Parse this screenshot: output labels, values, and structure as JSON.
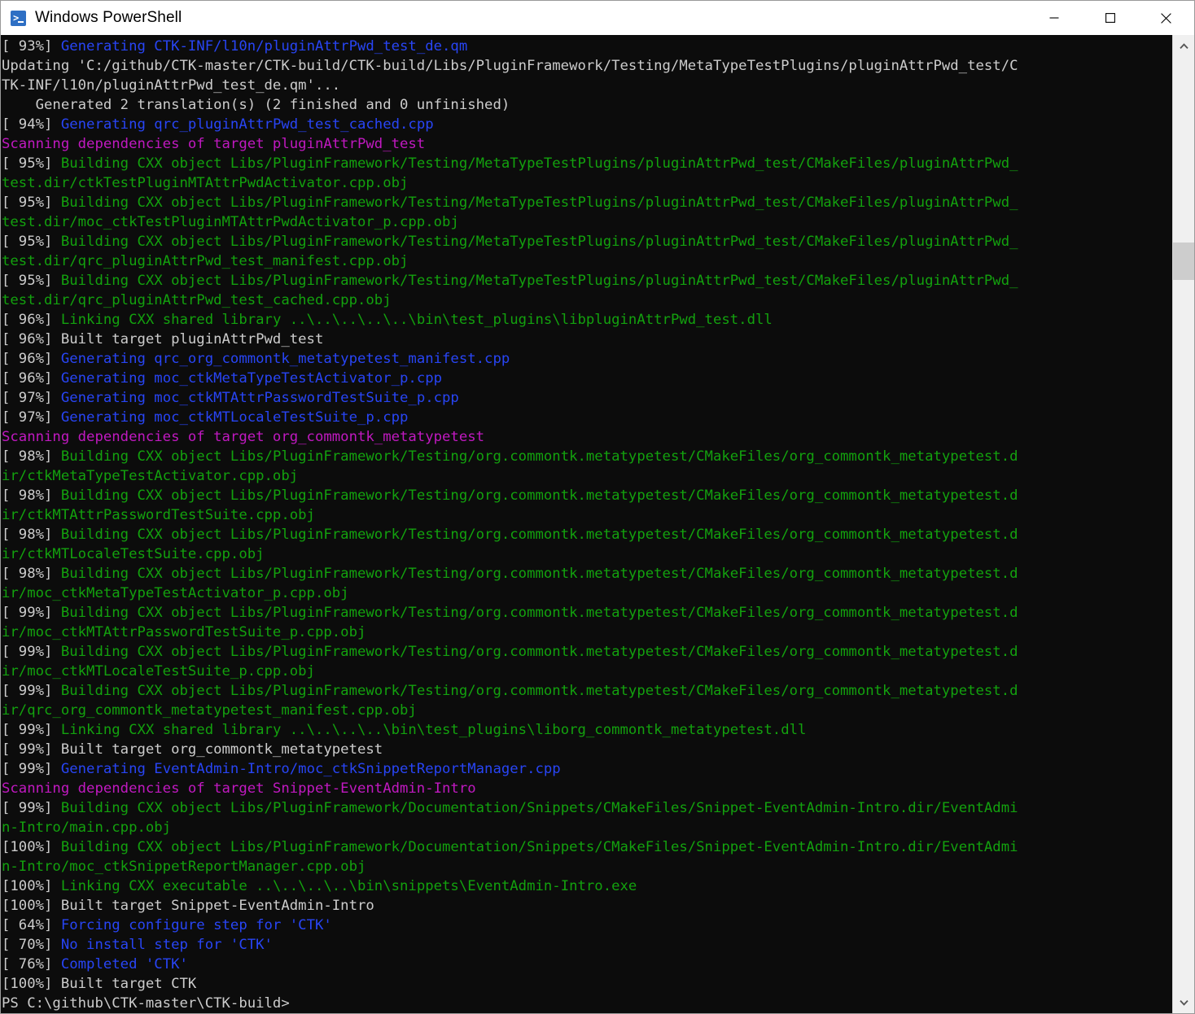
{
  "window": {
    "title": "Windows PowerShell",
    "icon": "powershell-icon",
    "controls": {
      "minimize_label": "Minimize",
      "maximize_label": "Maximize",
      "close_label": "Close"
    }
  },
  "theme": {
    "background": "#0c0c0c",
    "default_text": "#cccccc",
    "green": "#13a10e",
    "blue": "#2845f5",
    "magenta": "#c019c0",
    "titlebar_background": "#ffffff",
    "titlebar_text": "#000000",
    "scrollbar_track": "#f0f0f0",
    "scrollbar_thumb": "#cdcdcd"
  },
  "scrollbar": {
    "up_arrow": "chevron-up-icon",
    "down_arrow": "chevron-down-icon",
    "thumb_label": "scroll-thumb"
  },
  "terminal": {
    "prompt": "PS C:\\github\\CTK-master\\CTK-build>",
    "lines": [
      {
        "segments": [
          {
            "t": "[ 93%] ",
            "c": "c-white"
          },
          {
            "t": "Generating CTK-INF/l10n/pluginAttrPwd_test_de.qm",
            "c": "c-blue"
          }
        ]
      },
      {
        "segments": [
          {
            "t": "Updating 'C:/github/CTK-master/CTK-build/CTK-build/Libs/PluginFramework/Testing/MetaTypeTestPlugins/pluginAttrPwd_test/C",
            "c": "c-white"
          }
        ]
      },
      {
        "segments": [
          {
            "t": "TK-INF/l10n/pluginAttrPwd_test_de.qm'...",
            "c": "c-white"
          }
        ]
      },
      {
        "segments": [
          {
            "t": "    Generated 2 translation(s) (2 finished and 0 unfinished)",
            "c": "c-white"
          }
        ]
      },
      {
        "segments": [
          {
            "t": "[ 94%] ",
            "c": "c-white"
          },
          {
            "t": "Generating qrc_pluginAttrPwd_test_cached.cpp",
            "c": "c-blue"
          }
        ]
      },
      {
        "segments": [
          {
            "t": "Scanning dependencies of target pluginAttrPwd_test",
            "c": "c-magenta"
          }
        ]
      },
      {
        "segments": [
          {
            "t": "[ 95%] ",
            "c": "c-white"
          },
          {
            "t": "Building CXX object Libs/PluginFramework/Testing/MetaTypeTestPlugins/pluginAttrPwd_test/CMakeFiles/pluginAttrPwd_",
            "c": "c-green"
          }
        ]
      },
      {
        "segments": [
          {
            "t": "test.dir/ctkTestPluginMTAttrPwdActivator.cpp.obj",
            "c": "c-green"
          }
        ]
      },
      {
        "segments": [
          {
            "t": "[ 95%] ",
            "c": "c-white"
          },
          {
            "t": "Building CXX object Libs/PluginFramework/Testing/MetaTypeTestPlugins/pluginAttrPwd_test/CMakeFiles/pluginAttrPwd_",
            "c": "c-green"
          }
        ]
      },
      {
        "segments": [
          {
            "t": "test.dir/moc_ctkTestPluginMTAttrPwdActivator_p.cpp.obj",
            "c": "c-green"
          }
        ]
      },
      {
        "segments": [
          {
            "t": "[ 95%] ",
            "c": "c-white"
          },
          {
            "t": "Building CXX object Libs/PluginFramework/Testing/MetaTypeTestPlugins/pluginAttrPwd_test/CMakeFiles/pluginAttrPwd_",
            "c": "c-green"
          }
        ]
      },
      {
        "segments": [
          {
            "t": "test.dir/qrc_pluginAttrPwd_test_manifest.cpp.obj",
            "c": "c-green"
          }
        ]
      },
      {
        "segments": [
          {
            "t": "[ 95%] ",
            "c": "c-white"
          },
          {
            "t": "Building CXX object Libs/PluginFramework/Testing/MetaTypeTestPlugins/pluginAttrPwd_test/CMakeFiles/pluginAttrPwd_",
            "c": "c-green"
          }
        ]
      },
      {
        "segments": [
          {
            "t": "test.dir/qrc_pluginAttrPwd_test_cached.cpp.obj",
            "c": "c-green"
          }
        ]
      },
      {
        "segments": [
          {
            "t": "[ 96%] ",
            "c": "c-white"
          },
          {
            "t": "Linking CXX shared library ..\\..\\..\\..\\..\\bin\\test_plugins\\libpluginAttrPwd_test.dll",
            "c": "c-green"
          }
        ]
      },
      {
        "segments": [
          {
            "t": "[ 96%] Built target pluginAttrPwd_test",
            "c": "c-white"
          }
        ]
      },
      {
        "segments": [
          {
            "t": "[ 96%] ",
            "c": "c-white"
          },
          {
            "t": "Generating qrc_org_commontk_metatypetest_manifest.cpp",
            "c": "c-blue"
          }
        ]
      },
      {
        "segments": [
          {
            "t": "[ 96%] ",
            "c": "c-white"
          },
          {
            "t": "Generating moc_ctkMetaTypeTestActivator_p.cpp",
            "c": "c-blue"
          }
        ]
      },
      {
        "segments": [
          {
            "t": "[ 97%] ",
            "c": "c-white"
          },
          {
            "t": "Generating moc_ctkMTAttrPasswordTestSuite_p.cpp",
            "c": "c-blue"
          }
        ]
      },
      {
        "segments": [
          {
            "t": "[ 97%] ",
            "c": "c-white"
          },
          {
            "t": "Generating moc_ctkMTLocaleTestSuite_p.cpp",
            "c": "c-blue"
          }
        ]
      },
      {
        "segments": [
          {
            "t": "Scanning dependencies of target org_commontk_metatypetest",
            "c": "c-magenta"
          }
        ]
      },
      {
        "segments": [
          {
            "t": "[ 98%] ",
            "c": "c-white"
          },
          {
            "t": "Building CXX object Libs/PluginFramework/Testing/org.commontk.metatypetest/CMakeFiles/org_commontk_metatypetest.d",
            "c": "c-green"
          }
        ]
      },
      {
        "segments": [
          {
            "t": "ir/ctkMetaTypeTestActivator.cpp.obj",
            "c": "c-green"
          }
        ]
      },
      {
        "segments": [
          {
            "t": "[ 98%] ",
            "c": "c-white"
          },
          {
            "t": "Building CXX object Libs/PluginFramework/Testing/org.commontk.metatypetest/CMakeFiles/org_commontk_metatypetest.d",
            "c": "c-green"
          }
        ]
      },
      {
        "segments": [
          {
            "t": "ir/ctkMTAttrPasswordTestSuite.cpp.obj",
            "c": "c-green"
          }
        ]
      },
      {
        "segments": [
          {
            "t": "[ 98%] ",
            "c": "c-white"
          },
          {
            "t": "Building CXX object Libs/PluginFramework/Testing/org.commontk.metatypetest/CMakeFiles/org_commontk_metatypetest.d",
            "c": "c-green"
          }
        ]
      },
      {
        "segments": [
          {
            "t": "ir/ctkMTLocaleTestSuite.cpp.obj",
            "c": "c-green"
          }
        ]
      },
      {
        "segments": [
          {
            "t": "[ 98%] ",
            "c": "c-white"
          },
          {
            "t": "Building CXX object Libs/PluginFramework/Testing/org.commontk.metatypetest/CMakeFiles/org_commontk_metatypetest.d",
            "c": "c-green"
          }
        ]
      },
      {
        "segments": [
          {
            "t": "ir/moc_ctkMetaTypeTestActivator_p.cpp.obj",
            "c": "c-green"
          }
        ]
      },
      {
        "segments": [
          {
            "t": "[ 99%] ",
            "c": "c-white"
          },
          {
            "t": "Building CXX object Libs/PluginFramework/Testing/org.commontk.metatypetest/CMakeFiles/org_commontk_metatypetest.d",
            "c": "c-green"
          }
        ]
      },
      {
        "segments": [
          {
            "t": "ir/moc_ctkMTAttrPasswordTestSuite_p.cpp.obj",
            "c": "c-green"
          }
        ]
      },
      {
        "segments": [
          {
            "t": "[ 99%] ",
            "c": "c-white"
          },
          {
            "t": "Building CXX object Libs/PluginFramework/Testing/org.commontk.metatypetest/CMakeFiles/org_commontk_metatypetest.d",
            "c": "c-green"
          }
        ]
      },
      {
        "segments": [
          {
            "t": "ir/moc_ctkMTLocaleTestSuite_p.cpp.obj",
            "c": "c-green"
          }
        ]
      },
      {
        "segments": [
          {
            "t": "[ 99%] ",
            "c": "c-white"
          },
          {
            "t": "Building CXX object Libs/PluginFramework/Testing/org.commontk.metatypetest/CMakeFiles/org_commontk_metatypetest.d",
            "c": "c-green"
          }
        ]
      },
      {
        "segments": [
          {
            "t": "ir/qrc_org_commontk_metatypetest_manifest.cpp.obj",
            "c": "c-green"
          }
        ]
      },
      {
        "segments": [
          {
            "t": "[ 99%] ",
            "c": "c-white"
          },
          {
            "t": "Linking CXX shared library ..\\..\\..\\..\\bin\\test_plugins\\liborg_commontk_metatypetest.dll",
            "c": "c-green"
          }
        ]
      },
      {
        "segments": [
          {
            "t": "[ 99%] Built target org_commontk_metatypetest",
            "c": "c-white"
          }
        ]
      },
      {
        "segments": [
          {
            "t": "[ 99%] ",
            "c": "c-white"
          },
          {
            "t": "Generating EventAdmin-Intro/moc_ctkSnippetReportManager.cpp",
            "c": "c-blue"
          }
        ]
      },
      {
        "segments": [
          {
            "t": "Scanning dependencies of target Snippet-EventAdmin-Intro",
            "c": "c-magenta"
          }
        ]
      },
      {
        "segments": [
          {
            "t": "[ 99%] ",
            "c": "c-white"
          },
          {
            "t": "Building CXX object Libs/PluginFramework/Documentation/Snippets/CMakeFiles/Snippet-EventAdmin-Intro.dir/EventAdmi",
            "c": "c-green"
          }
        ]
      },
      {
        "segments": [
          {
            "t": "n-Intro/main.cpp.obj",
            "c": "c-green"
          }
        ]
      },
      {
        "segments": [
          {
            "t": "[100%] ",
            "c": "c-white"
          },
          {
            "t": "Building CXX object Libs/PluginFramework/Documentation/Snippets/CMakeFiles/Snippet-EventAdmin-Intro.dir/EventAdmi",
            "c": "c-green"
          }
        ]
      },
      {
        "segments": [
          {
            "t": "n-Intro/moc_ctkSnippetReportManager.cpp.obj",
            "c": "c-green"
          }
        ]
      },
      {
        "segments": [
          {
            "t": "[100%] ",
            "c": "c-white"
          },
          {
            "t": "Linking CXX executable ..\\..\\..\\..\\bin\\snippets\\EventAdmin-Intro.exe",
            "c": "c-green"
          }
        ]
      },
      {
        "segments": [
          {
            "t": "[100%] Built target Snippet-EventAdmin-Intro",
            "c": "c-white"
          }
        ]
      },
      {
        "segments": [
          {
            "t": "[ 64%] ",
            "c": "c-white"
          },
          {
            "t": "Forcing configure step for 'CTK'",
            "c": "c-blue"
          }
        ]
      },
      {
        "segments": [
          {
            "t": "[ 70%] ",
            "c": "c-white"
          },
          {
            "t": "No install step for 'CTK'",
            "c": "c-blue"
          }
        ]
      },
      {
        "segments": [
          {
            "t": "[ 76%] ",
            "c": "c-white"
          },
          {
            "t": "Completed 'CTK'",
            "c": "c-blue"
          }
        ]
      },
      {
        "segments": [
          {
            "t": "[100%] Built target CTK",
            "c": "c-white"
          }
        ]
      },
      {
        "segments": [
          {
            "t": "PS C:\\github\\CTK-master\\CTK-build>",
            "c": "c-white"
          }
        ]
      }
    ]
  }
}
